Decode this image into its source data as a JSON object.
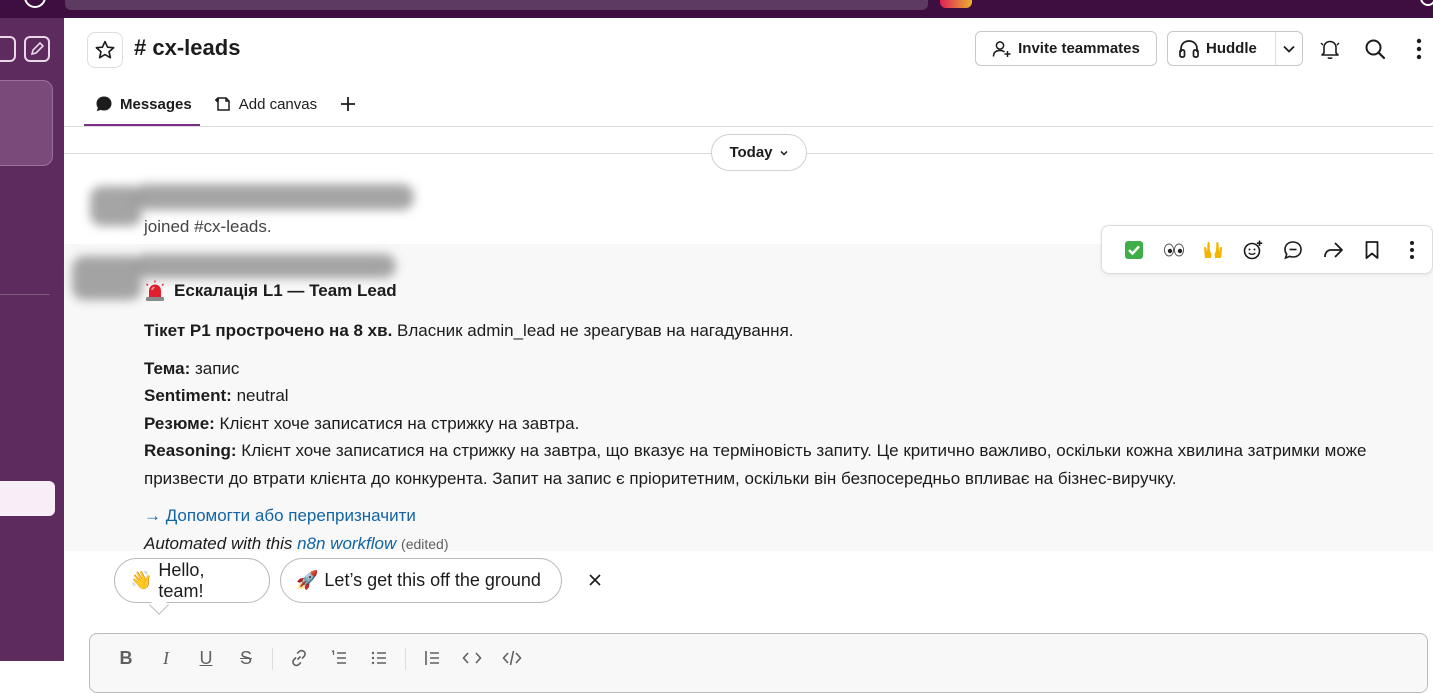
{
  "header": {
    "channel_hash": "#",
    "channel_name": "cx-leads",
    "invite_label": "Invite teammates",
    "huddle_label": "Huddle"
  },
  "tabs": [
    {
      "label": "Messages",
      "icon": "chat-bubble-icon",
      "active": true
    },
    {
      "label": "Add canvas",
      "icon": "canvas-icon",
      "active": false
    }
  ],
  "date_divider": {
    "label": "Today"
  },
  "join_message": {
    "text": "joined #cx-leads."
  },
  "message": {
    "title_emoji": "rotating-light-icon",
    "title": "Ескалація L1 — Team Lead",
    "line1_bold": "Тікет P1 прострочено на 8 хв.",
    "line1_rest": " Власник admin_lead не зреагував на нагадування.",
    "topic_label": "Тема:",
    "topic_value": " запис",
    "sentiment_label": "Sentiment:",
    "sentiment_value": " neutral",
    "summary_label": "Резюме:",
    "summary_value": " Клієнт хоче записатися на стрижку на завтра.",
    "reasoning_label": "Reasoning:",
    "reasoning_value": " Клієнт хоче записатися на стрижку на завтра, що вказує на терміновість запиту. Це критично важливо, оскільки кожна хвилина затримки може призвести до втрати клієнта до конкурента. Запит на запис є пріоритетним, оскільки він безпосередньо впливає на бізнес-виручку.",
    "action_link": "→ Допомогти або перепризначити",
    "automated_prefix": "Automated with this ",
    "automated_link": "n8n workflow",
    "edited": "(edited)"
  },
  "action_bar": [
    "check-mark-emoji-icon",
    "eyes-emoji-icon",
    "raised-hands-emoji-icon",
    "add-reaction-icon",
    "reply-thread-icon",
    "forward-icon",
    "bookmark-icon",
    "more-actions-icon"
  ],
  "suggestions": [
    {
      "emoji": "👋",
      "text": "Hello, team!"
    },
    {
      "emoji": "🚀",
      "text": "Let’s get this off the ground"
    }
  ],
  "composer_toolbar": [
    "bold-icon",
    "italic-icon",
    "underline-icon",
    "strikethrough-icon",
    "link-icon",
    "ordered-list-icon",
    "bullet-list-icon",
    "blockquote-icon",
    "code-icon",
    "code-block-icon"
  ],
  "colors": {
    "sidebar": "#5e2b5e",
    "topbar": "#3f0e40",
    "link": "#1264a3",
    "tab_underline": "#7c3085",
    "siren_red": "#e01e2e"
  }
}
